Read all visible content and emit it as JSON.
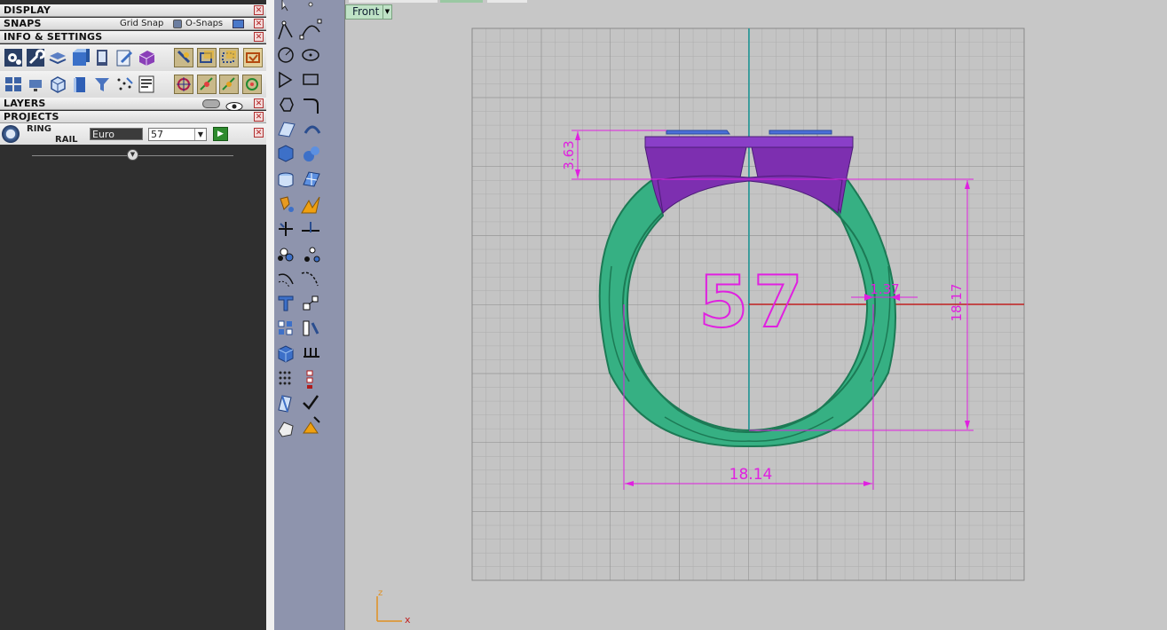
{
  "panel": {
    "sections": {
      "display": "DISPLAY",
      "snaps": "SNAPS",
      "info": "INFO & SETTINGS",
      "layers": "LAYERS",
      "projects": "PROJECTS"
    },
    "snaps": {
      "grid_snap_label": "Grid Snap",
      "osnaps_label": "O-Snaps"
    },
    "ring": {
      "label_line1": "RING",
      "label_line2": "RAIL",
      "standard_value": "Euro",
      "size_value": "57"
    }
  },
  "viewport": {
    "name": "Front",
    "size_text": "57",
    "dimensions": {
      "top_height": "3.63",
      "thickness": "1.37",
      "inner_height": "18.17",
      "inner_width": "18.14"
    },
    "axes": {
      "z": "z",
      "x": "x"
    }
  },
  "colors": {
    "ring_body": "#36b083",
    "ring_dark": "#1c7a55",
    "head": "#7d2fb0",
    "stones": "#4a6fd8",
    "dimension": "#e020e0",
    "grid_major": "#8a8a8a",
    "grid_minor": "#aaaaaa",
    "axis_x": "#c02020",
    "axis_z": "#1a9a9a"
  }
}
